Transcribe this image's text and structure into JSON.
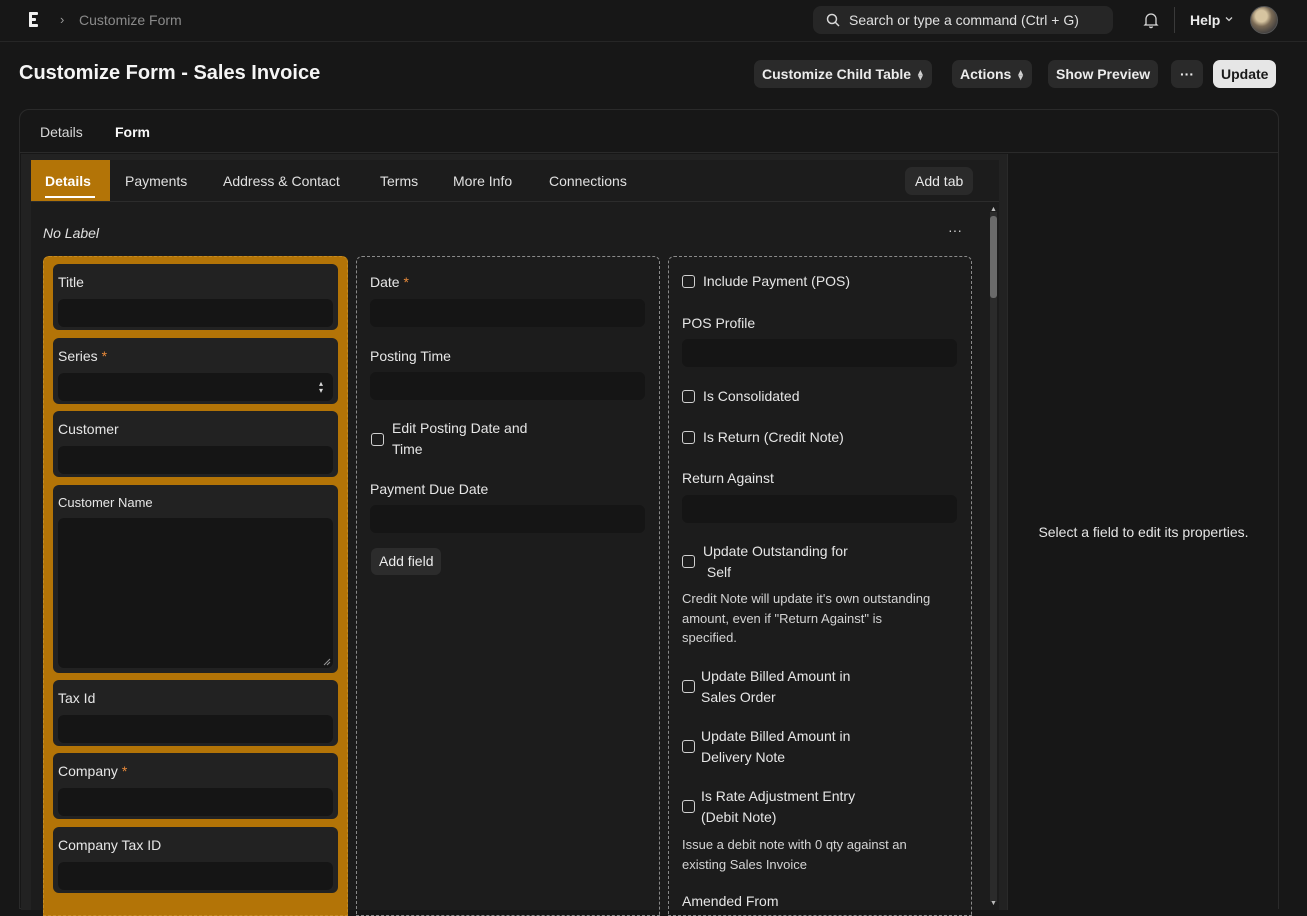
{
  "navbar": {
    "breadcrumb": "Customize Form",
    "search_placeholder": "Search or type a command (Ctrl + G)",
    "help_label": "Help"
  },
  "page": {
    "title": "Customize Form - Sales Invoice",
    "buttons": {
      "customize_child_table": "Customize Child Table",
      "actions": "Actions",
      "show_preview": "Show Preview",
      "more": "···",
      "update": "Update"
    }
  },
  "top_tabs": [
    "Details",
    "Form"
  ],
  "form_tabs": [
    "Details",
    "Payments",
    "Address & Contact",
    "Terms",
    "More Info",
    "Connections"
  ],
  "add_tab_label": "Add tab",
  "section": {
    "label": "No Label",
    "menu": "···"
  },
  "column1": [
    {
      "label": "Title",
      "required": false
    },
    {
      "label": "Series",
      "required": true
    },
    {
      "label": "Customer",
      "required": false
    },
    {
      "label": "Customer Name",
      "required": false
    },
    {
      "label": "Tax Id",
      "required": false
    },
    {
      "label": "Company",
      "required": true
    },
    {
      "label": "Company Tax ID",
      "required": false
    }
  ],
  "column2": {
    "date_label": "Date",
    "posting_time_label": "Posting Time",
    "edit_posting_line1": "Edit Posting Date and",
    "edit_posting_line2": "Time",
    "payment_due_label": "Payment Due Date",
    "add_field_label": "Add field"
  },
  "column3": {
    "include_payment": "Include Payment (POS)",
    "pos_profile": "POS Profile",
    "is_consolidated": "Is Consolidated",
    "is_return": "Is Return (Credit Note)",
    "return_against": "Return Against",
    "update_outstanding_l1": "Update Outstanding for",
    "update_outstanding_l2": "Self",
    "credit_note_help_l1": "Credit Note will update it's own outstanding",
    "credit_note_help_l2": "amount, even if \"Return Against\" is",
    "credit_note_help_l3": "specified.",
    "billed_so_l1": "Update Billed Amount in",
    "billed_so_l2": "Sales Order",
    "billed_dn_l1": "Update Billed Amount in",
    "billed_dn_l2": "Delivery Note",
    "rate_adj_l1": "Is Rate Adjustment Entry",
    "rate_adj_l2": "(Debit Note)",
    "debit_help_l1": "Issue a debit note with 0 qty against an",
    "debit_help_l2": "existing Sales Invoice",
    "amended_from": "Amended From"
  },
  "right_panel": {
    "message": "Select a field to edit its properties."
  },
  "colors": {
    "accent": "#b37407",
    "required": "#e98a3a",
    "background": "#171717"
  }
}
